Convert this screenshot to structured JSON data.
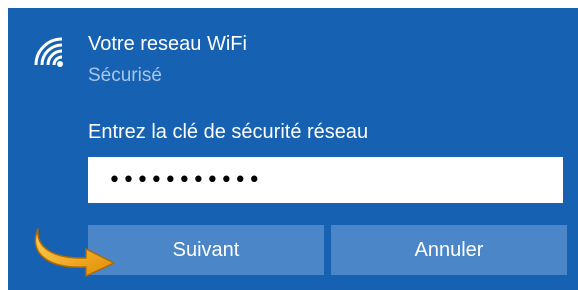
{
  "network": {
    "name": "Votre reseau WiFi",
    "status": "Sécurisé",
    "icon": "wifi-secured-icon"
  },
  "key_prompt": {
    "label": "Entrez la clé de sécurité réseau",
    "value": "xxxxxxxxxxx"
  },
  "buttons": {
    "next_label": "Suivant",
    "cancel_label": "Annuler"
  },
  "annotation": {
    "icon": "pointing-arrow-icon"
  },
  "colors": {
    "panel": "#1661b1",
    "button": "#4a86c8",
    "arrow": "#f5a800"
  }
}
